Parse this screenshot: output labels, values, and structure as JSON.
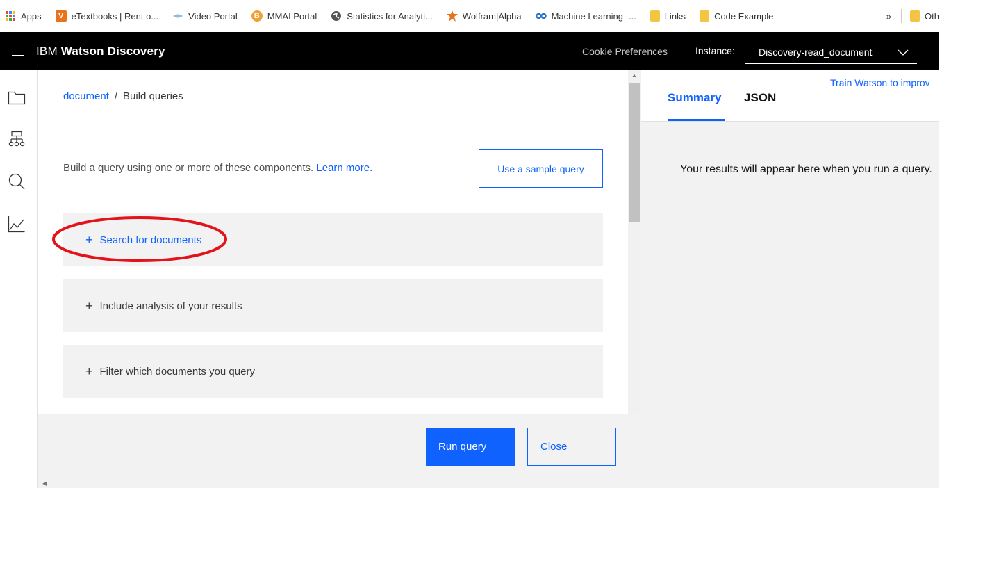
{
  "bookmarks": {
    "items": [
      {
        "label": "Apps",
        "icon": "apps-grid-icon"
      },
      {
        "label": "eTextbooks | Rent o...",
        "icon": "vitalsource-icon"
      },
      {
        "label": "Video Portal",
        "icon": "video-portal-icon"
      },
      {
        "label": "MMAI Portal",
        "icon": "mmai-icon"
      },
      {
        "label": "Statistics for Analyti...",
        "icon": "globe-icon"
      },
      {
        "label": "Wolfram|Alpha",
        "icon": "wolfram-icon"
      },
      {
        "label": "Machine Learning -...",
        "icon": "coursera-icon"
      },
      {
        "label": "Links",
        "icon": "folder-icon"
      },
      {
        "label": "Code Example",
        "icon": "folder-icon"
      }
    ],
    "more": "»",
    "other": "Oth"
  },
  "header": {
    "brand_prefix": "IBM",
    "brand_name": "Watson Discovery",
    "cookie": "Cookie Preferences",
    "instance_label": "Instance:",
    "instance_value": "Discovery-read_document"
  },
  "rail": {
    "icons": [
      "folder-icon",
      "network-icon",
      "search-icon",
      "analytics-icon"
    ]
  },
  "main": {
    "breadcrumb_link": "document",
    "breadcrumb_sep": "/",
    "breadcrumb_current": "Build queries",
    "intro_text": "Build a query using one or more of these components.",
    "learn_more": "Learn more.",
    "sample_button": "Use a sample query",
    "tiles": [
      {
        "label": "Search for documents"
      },
      {
        "label": "Include analysis of your results"
      },
      {
        "label": "Filter which documents you query"
      }
    ],
    "run_button": "Run query",
    "close_button": "Close"
  },
  "results": {
    "train_link": "Train Watson to improv",
    "tabs": [
      "Summary",
      "JSON"
    ],
    "placeholder": "Your results will appear here when you run a query."
  },
  "colors": {
    "accent": "#0f62fe",
    "header_bg": "#000000",
    "tile_bg": "#f2f2f2",
    "annotation": "#e3131b"
  }
}
